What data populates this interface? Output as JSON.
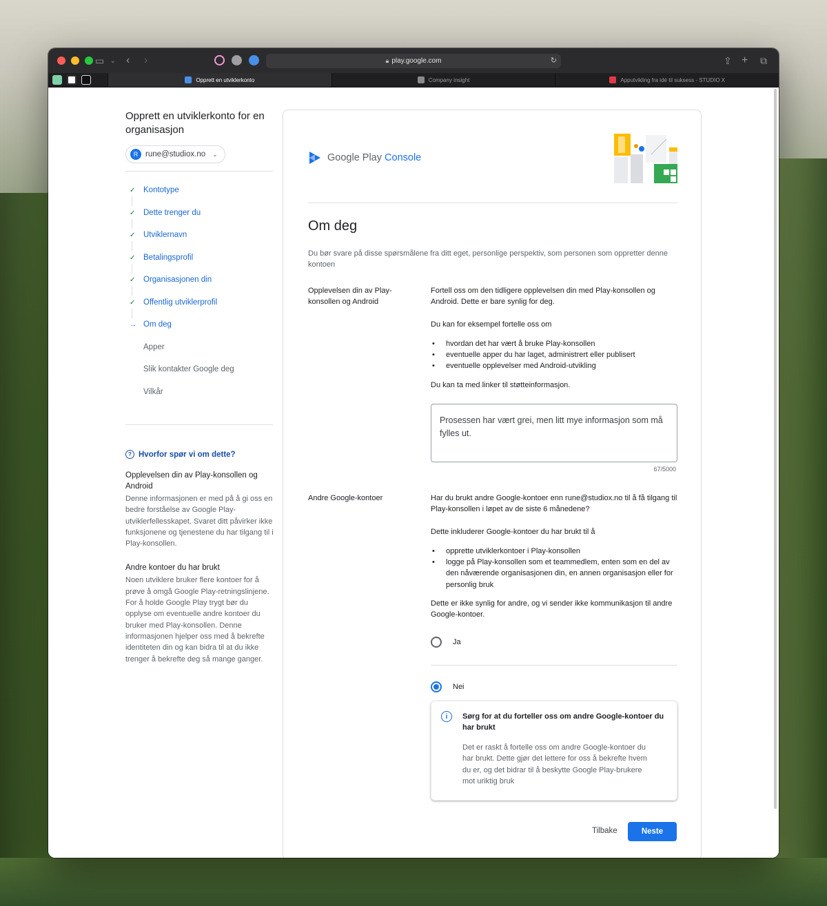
{
  "browser": {
    "url": "play.google.com",
    "tabs": [
      {
        "title": "Opprett en utviklerkonto",
        "active": true
      },
      {
        "title": "Company insight",
        "active": false
      },
      {
        "title": "Apputvikling fra idé til suksess - STUDIO X",
        "active": false
      }
    ]
  },
  "sidebar": {
    "heading": "Opprett en utviklerkonto for en organisasjon",
    "account_initial": "R",
    "account_email": "rune@studiox.no",
    "steps": [
      {
        "label": "Kontotype",
        "state": "done"
      },
      {
        "label": "Dette trenger du",
        "state": "done"
      },
      {
        "label": "Utviklernavn",
        "state": "done"
      },
      {
        "label": "Betalingsprofil",
        "state": "done"
      },
      {
        "label": "Organisasjonen din",
        "state": "done"
      },
      {
        "label": "Offentlig utviklerprofil",
        "state": "done"
      },
      {
        "label": "Om deg",
        "state": "current"
      },
      {
        "label": "Apper",
        "state": "pending"
      },
      {
        "label": "Slik kontakter Google deg",
        "state": "pending"
      },
      {
        "label": "Vilkår",
        "state": "pending"
      }
    ],
    "why_link": "Hvorfor spør vi om dette?",
    "info": [
      {
        "heading": "Opplevelsen din av Play-konsollen og Android",
        "text": "Denne informasjonen er med på å gi oss en bedre forståelse av Google Play-utviklerfellesskapet. Svaret ditt påvirker ikke funksjonene og tjenestene du har tilgang til i Play-konsollen."
      },
      {
        "heading": "Andre kontoer du har brukt",
        "text": "Noen utviklere bruker flere kontoer for å prøve å omgå Google Play-retningslinjene. For å holde Google Play trygt bør du opplyse om eventuelle andre kontoer du bruker med Play-konsollen. Denne informasjonen hjelper oss med å bekrefte identiteten din og kan bidra til at du ikke trenger å bekrefte deg så mange ganger."
      }
    ]
  },
  "main": {
    "logo_text_a": "Google Play ",
    "logo_text_b": "Console",
    "title": "Om deg",
    "intro": "Du bør svare på disse spørsmålene fra ditt eget, personlige perspektiv, som personen som oppretter denne kontoen",
    "experience": {
      "label": "Opplevelsen din av Play-konsollen og Android",
      "desc": "Fortell oss om den tidligere opplevelsen din med Play-konsollen og Android. Dette er bare synlig for deg.",
      "example_intro": "Du kan for eksempel fortelle oss om",
      "bullets": [
        "hvordan det har vært å bruke Play-konsollen",
        "eventuelle apper du har laget, administrert eller publisert",
        "eventuelle opplevelser med Android-utvikling"
      ],
      "links_note": "Du kan ta med linker til støtteinformasjon.",
      "answer": "Prosessen har vært grei, men litt mye informasjon som må fylles ut.",
      "counter": "67/5000"
    },
    "other_accounts": {
      "label": "Andre Google-kontoer",
      "question": "Har du brukt andre Google-kontoer enn rune@studiox.no til å få tilgang til Play-konsollen i løpet av de siste 6 månedene?",
      "includes": "Dette inkluderer Google-kontoer du har brukt til å",
      "bullets": [
        "opprette utviklerkontoer i Play-konsollen",
        "logge på Play-konsollen som et teammedlem, enten som en del av den nåværende organisasjonen din, en annen organisasjon eller for personlig bruk"
      ],
      "note": "Dette er ikke synlig for andre, og vi sender ikke kommunikasjon til andre Google-kontoer.",
      "option_yes": "Ja",
      "option_no": "Nei",
      "selected": "Nei",
      "alert_heading": "Sørg for at du forteller oss om andre Google-kontoer du har brukt",
      "alert_text": "Det er raskt å fortelle oss om andre Google-kontoer du har brukt. Dette gjør det lettere for oss å bekrefte hvem du er, og det bidrar til å beskytte Google Play-brukere mot uriktig bruk"
    },
    "back_label": "Tilbake",
    "next_label": "Neste"
  },
  "colors": {
    "accent": "#1a73e8",
    "done": "#137333"
  }
}
